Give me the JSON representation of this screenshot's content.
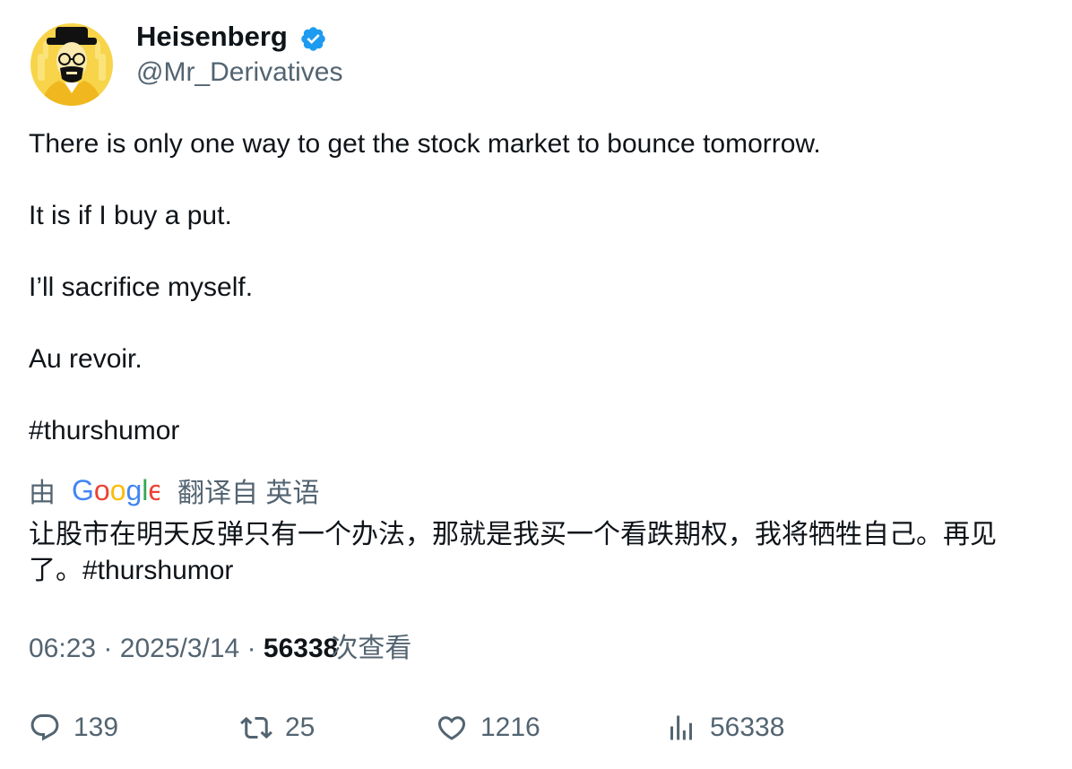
{
  "author": {
    "name": "Heisenberg",
    "handle": "@Mr_Derivatives",
    "verified": true,
    "verified_color": "#1d9bf0",
    "avatar_icon": "heisenberg-avatar",
    "avatar_color": "#f7d44a"
  },
  "tweet": {
    "paragraphs": [
      "There is only one way to get the stock market to bounce tomorrow.",
      "It is if I buy a put.",
      "I’ll sacrifice myself.",
      "Au revoir.",
      "#thurshumor"
    ]
  },
  "translation": {
    "prefix": "由",
    "provider": "Google",
    "suffix": "翻译自 英语",
    "text": "让股市在明天反弹只有一个办法，那就是我买一个看跌期权，我将牺牲自己。再见了。#thurshumor"
  },
  "meta": {
    "time": "06:23",
    "date": "2025/3/14",
    "separator": "·",
    "views": "56338",
    "views_label": "次查看"
  },
  "actions": {
    "replies": "139",
    "retweets": "25",
    "likes": "1216",
    "views": "56338"
  }
}
